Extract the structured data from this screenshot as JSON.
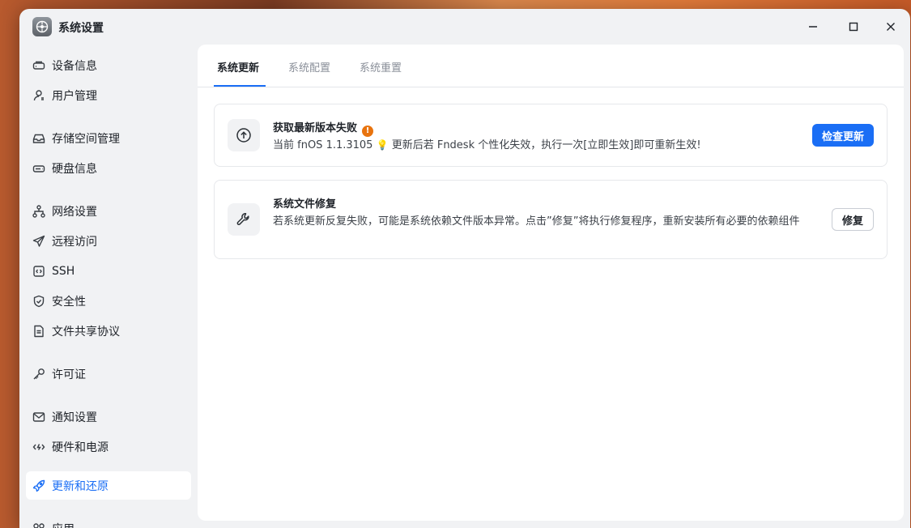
{
  "window": {
    "title": "系统设置"
  },
  "sidebar": {
    "items": [
      {
        "label": "设备信息",
        "icon": "device-icon"
      },
      {
        "label": "用户管理",
        "icon": "user-icon"
      },
      {
        "label": "存储空间管理",
        "icon": "storage-icon"
      },
      {
        "label": "硬盘信息",
        "icon": "disk-icon"
      },
      {
        "label": "网络设置",
        "icon": "network-icon"
      },
      {
        "label": "远程访问",
        "icon": "send-icon"
      },
      {
        "label": "SSH",
        "icon": "terminal-icon"
      },
      {
        "label": "安全性",
        "icon": "shield-icon"
      },
      {
        "label": "文件共享协议",
        "icon": "document-icon"
      },
      {
        "label": "许可证",
        "icon": "key-icon"
      },
      {
        "label": "通知设置",
        "icon": "mail-icon"
      },
      {
        "label": "硬件和电源",
        "icon": "power-icon"
      },
      {
        "label": "更新和还原",
        "icon": "rocket-icon",
        "active": true
      },
      {
        "label": "应用",
        "icon": "apps-icon"
      }
    ]
  },
  "tabs": [
    {
      "label": "系统更新",
      "active": true
    },
    {
      "label": "系统配置"
    },
    {
      "label": "系统重置"
    }
  ],
  "update_card": {
    "title": "获取最新版本失败",
    "warning_badge": "!",
    "desc_prefix": "当前 fnOS 1.1.3105",
    "bulb_icon": "💡",
    "desc_suffix": "更新后若 Fndesk 个性化失效，执行一次[立即生效]即可重新生效!",
    "button": "检查更新"
  },
  "repair_card": {
    "title": "系统文件修复",
    "desc": "若系统更新反复失败，可能是系统依赖文件版本异常。点击”修复”将执行修复程序，重新安装所有必要的依赖组件",
    "button": "修复"
  },
  "colors": {
    "accent": "#1a6ef5",
    "warning": "#e8730e"
  }
}
